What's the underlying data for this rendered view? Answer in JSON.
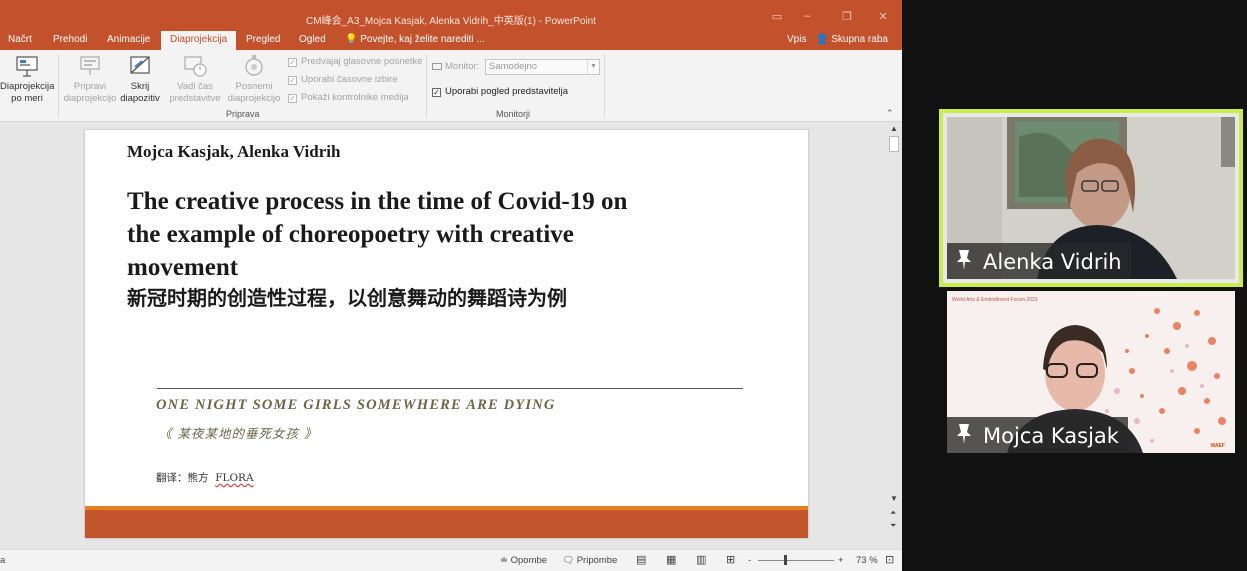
{
  "window": {
    "title": "CM峰会_A3_Mojca Kasjak, Alenka Vidrih_中英版(1) - PowerPoint"
  },
  "tabs": [
    {
      "label": "Načrt"
    },
    {
      "label": "Prehodi"
    },
    {
      "label": "Animacije"
    },
    {
      "label": "Diaprojekcija"
    },
    {
      "label": "Pregled"
    },
    {
      "label": "Ogled"
    }
  ],
  "tell_me": "Povejte, kaj želite narediti ...",
  "account": {
    "signin": "Vpis",
    "share": "Skupna raba"
  },
  "ribbon": {
    "custom_show": {
      "line1": "Diaprojekcija",
      "line2": "po meri"
    },
    "prepare_show": {
      "line1": "Pripravi",
      "line2": "diaprojekcijo"
    },
    "hide_slide": {
      "line1": "Skrij",
      "line2": "diapozitiv"
    },
    "rehearse": {
      "line1": "Vadi čas",
      "line2": "predstavitve"
    },
    "record": {
      "line1": "Posnemi",
      "line2": "diaprojekcijo"
    },
    "checks": [
      {
        "label": "Predvajaj glasovne posnetke",
        "checked": true
      },
      {
        "label": "Uporabi časovne izbire",
        "checked": true
      },
      {
        "label": "Pokaži kontrolnike medija",
        "checked": true
      }
    ],
    "group_setup": "Priprava",
    "monitor_label": "Monitor:",
    "monitor_value": "Samodejno",
    "presenter_view": {
      "label": "Uporabi pogled predstavitelja",
      "checked": true
    },
    "group_monitors": "Monitorji"
  },
  "slide": {
    "author": "Mojca Kasjak, Alenka Vidrih",
    "title_en_1": "The creative process in the time of Covid-19 on",
    "title_en_2": "the example of choreopoetry with creative",
    "title_en_3": "movement",
    "title_cn": "新冠时期的创造性过程，以创意舞动的舞蹈诗为例",
    "subtitle_en": "ONE NIGHT SOME GIRLS SOMEWHERE ARE DYING",
    "subtitle_cn": "《 某夜某地的垂死女孩 》",
    "translator_label": "翻译：熊方",
    "translator_name": "FLORA"
  },
  "statusbar": {
    "left": "a",
    "notes": "Opombe",
    "comments": "Pripombe",
    "zoom_minus": "-",
    "zoom_plus": "+",
    "zoom": "73 %"
  },
  "video": {
    "participant_1": "Alenka Vidrih",
    "participant_2": "Mojca Kasjak",
    "tile2_banner": "World Arts & Embodiment Forum 2023",
    "tile2_logo": "WAEF"
  },
  "colors": {
    "accent": "#c3512c",
    "speaker_border": "#c9ee4a",
    "slide_footer": "#c3562c"
  }
}
